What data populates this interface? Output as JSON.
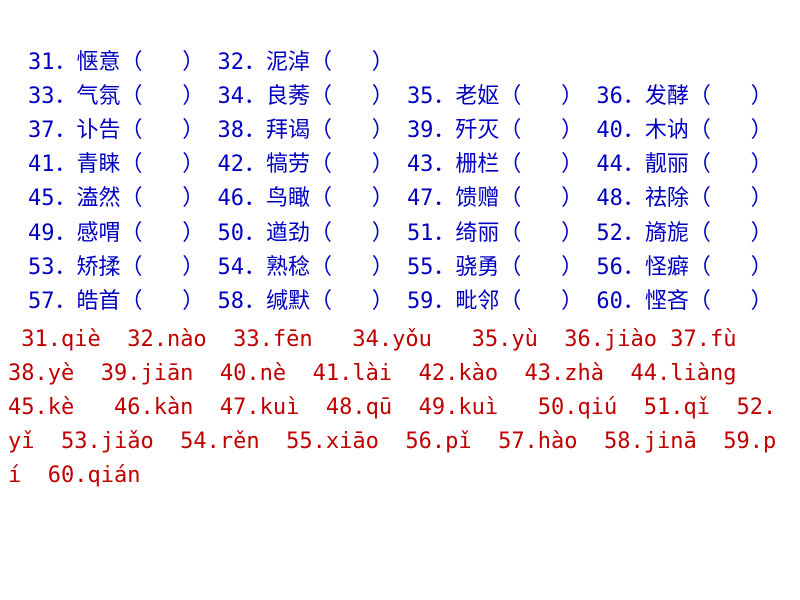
{
  "questions": {
    "l1": "31．惬意（   ） 32．泥淖（   ）",
    "l2": "33．气氛（   ） 34．良莠（   ） 35．老妪（   ） 36．发酵（   ）",
    "l3": "37．讣告（   ） 38．拜谒（   ） 39．歼灭（   ） 40．木讷（   ）",
    "l4": "41．青睐（   ） 42．犒劳（   ） 43．栅栏（   ） 44．靓丽（   ）",
    "l5": "45．溘然（   ） 46．鸟瞰（   ） 47．馈赠（   ） 48．祛除（   ）",
    "l6": "49．感喟（   ） 50．遒劲（   ） 51．绮丽（   ） 52．旖旎（   ）",
    "l7": "53．矫揉（   ） 54．熟稔（   ） 55．骁勇（   ） 56．怪癖（   ）",
    "l8": "57．皓首（   ） 58．缄默（   ） 59．毗邻（   ） 60．悭吝（   ）"
  },
  "answers": {
    "l1": " 31.qiè  32.nào  33.fēn   34.yǒu   35.yù  36.jiào 37.fù    38.yè  39.jiān  40.nè  41.lài  42.kào  43.zhà  44.liàng   45.kè   46.kàn  47.kuì  48.qū  49.kuì   50.qiú  51.qǐ  52.yǐ  53.jiǎo  54.rěn  55.xiāo  56.pǐ  57.hào  58.jinā  59.pí  60.qián"
  }
}
